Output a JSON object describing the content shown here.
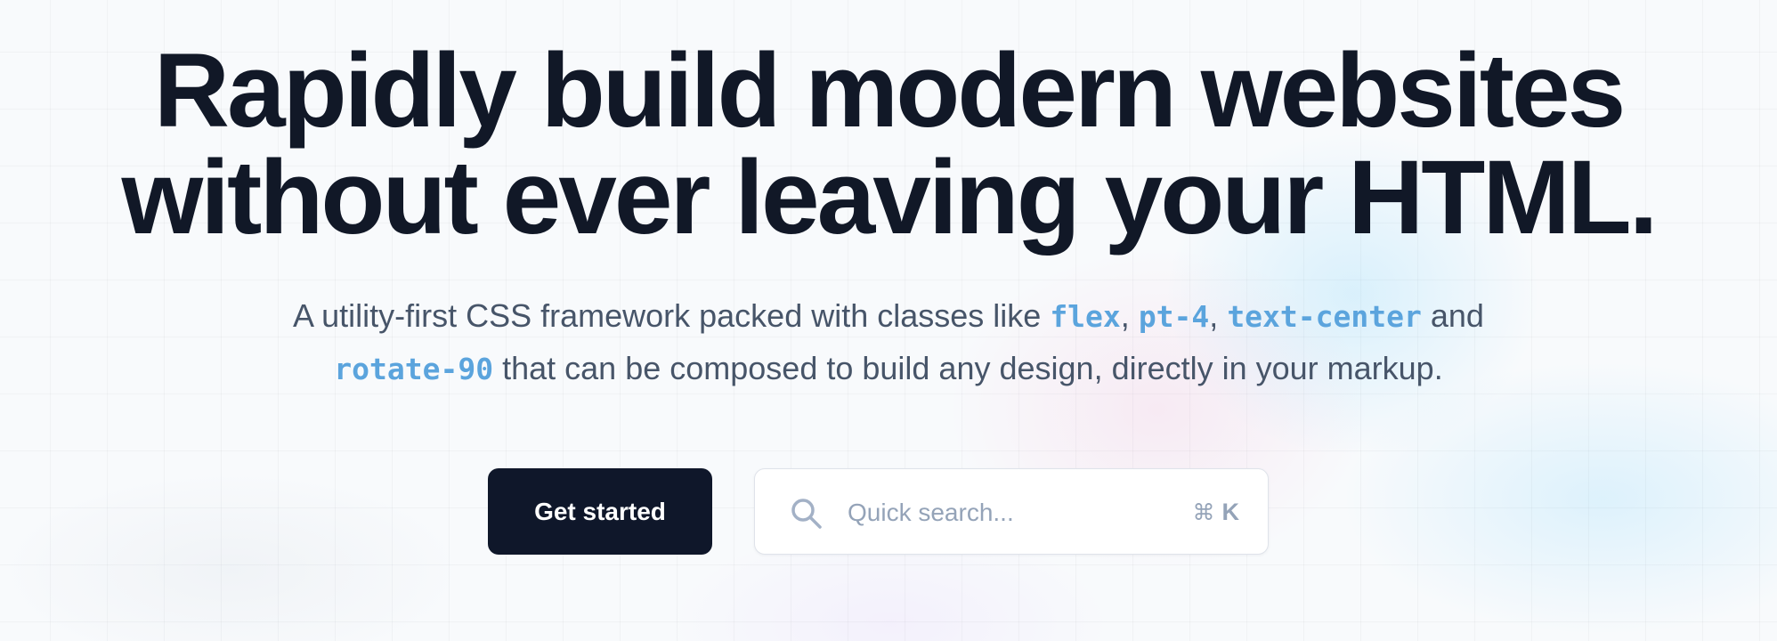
{
  "hero": {
    "headline_line1": "Rapidly build modern websites",
    "headline_line2": "without ever leaving your HTML.",
    "sub": {
      "part1": "A utility-first CSS framework packed with classes like ",
      "code1": "flex",
      "sep1": ", ",
      "code2": "pt-4",
      "sep2": ", ",
      "code3": "text-center",
      "part2": " and",
      "code4": "rotate-90",
      "part3": " that can be composed to build any design, directly in your markup."
    }
  },
  "actions": {
    "get_started_label": "Get started",
    "search": {
      "placeholder": "Quick search...",
      "shortcut_symbol": "⌘",
      "shortcut_key": "K"
    }
  },
  "icons": {
    "search": "search-icon",
    "command": "command-key-icon"
  },
  "colors": {
    "headline": "#111827",
    "body_text": "#475569",
    "code_accent": "#5ba4dd",
    "primary_button_bg": "#0f172a",
    "placeholder": "#94a3b8"
  }
}
